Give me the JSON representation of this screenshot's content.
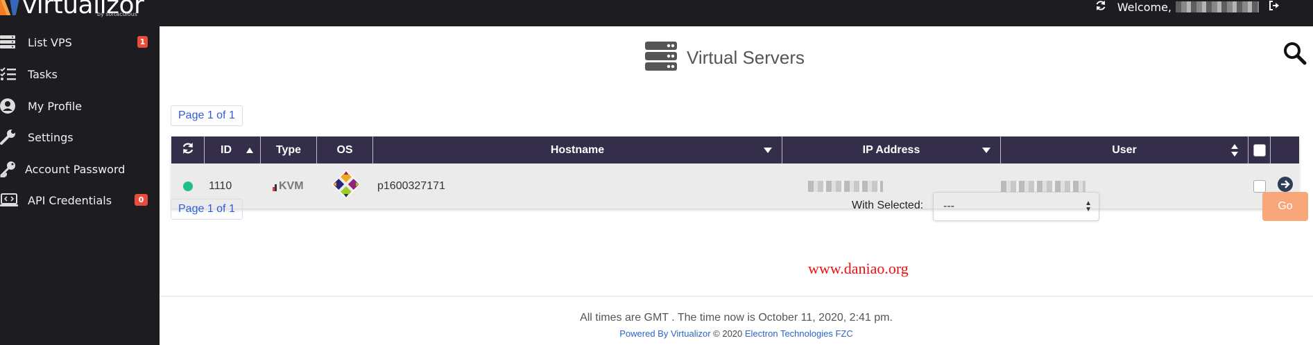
{
  "app": {
    "logo_text": "virtualizor",
    "logo_sub": "by softaculous"
  },
  "topbar": {
    "welcome_label": "Welcome,"
  },
  "sidebar": {
    "items": [
      {
        "label": "List VPS",
        "icon": "server-list-icon",
        "badge": "1"
      },
      {
        "label": "Tasks",
        "icon": "tasks-icon"
      },
      {
        "label": "My Profile",
        "icon": "user-circle-icon"
      },
      {
        "label": "Settings",
        "icon": "wrench-icon"
      },
      {
        "label": "Account Password",
        "icon": "key-icon"
      },
      {
        "label": "API Credentials",
        "icon": "laptop-code-icon",
        "badge": "0"
      }
    ]
  },
  "main": {
    "title": "Virtual Servers",
    "pager_top": "Page 1 of 1",
    "pager_bottom": "Page 1 of 1",
    "table": {
      "headers": {
        "id": "ID",
        "type": "Type",
        "os": "OS",
        "hostname": "Hostname",
        "ip": "IP Address",
        "user": "User"
      },
      "rows": [
        {
          "status": "online",
          "status_color": "#1fbf8f",
          "id": "1110",
          "type": "KVM",
          "os": "centos",
          "hostname": "p1600327171"
        }
      ]
    },
    "bulk": {
      "with_selected_label": "With Selected:",
      "select_value": "---",
      "go_label": "Go"
    },
    "watermark": "www.daniao.org",
    "footer": {
      "time_line": "All times are GMT . The time now is October 11, 2020, 2:41 pm.",
      "powered_by": "Powered By Virtualizor",
      "copyright": " © 2020 ",
      "company": "Electron Technologies FZC"
    }
  },
  "colors": {
    "sidebar_bg": "#1d1c21",
    "table_header_bg": "#342e4a",
    "badge_red": "#e74c3c",
    "link_blue": "#2f5cd6",
    "go_button": "#f7a77a",
    "status_online": "#1fbf8f"
  }
}
